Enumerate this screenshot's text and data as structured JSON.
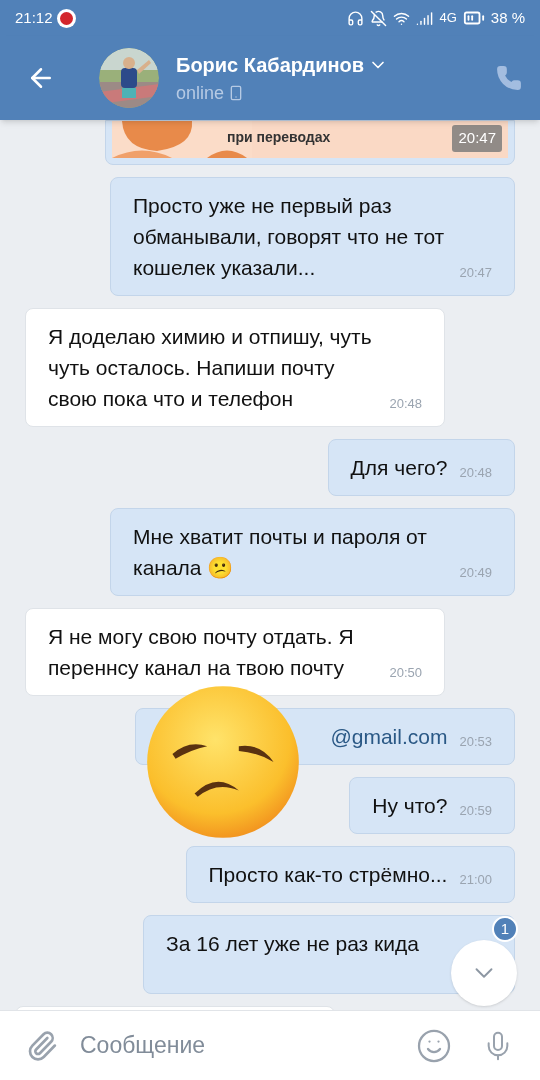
{
  "status_bar": {
    "time": "21:12",
    "network": "4G",
    "battery": "38 %"
  },
  "header": {
    "name": "Борис Кабардинов",
    "status": "online"
  },
  "image_message": {
    "caption": "при переводах",
    "time": "20:47"
  },
  "messages": [
    {
      "kind": "outgoing",
      "text": "Просто уже не первый раз обманывали, говорят что не тот кошелек указали...",
      "time": "20:47",
      "covered": false
    },
    {
      "kind": "incoming",
      "text": "Я доделаю химию и отпишу, чуть чуть осталось. Напиши почту свою пока что и телефон",
      "time": "20:48",
      "covered": false
    },
    {
      "kind": "outgoing",
      "text": "Для чего?",
      "time": "20:48",
      "covered": false
    },
    {
      "kind": "outgoing",
      "text": "Мне хватит почты и пароля от канала 😕",
      "time": "20:49",
      "covered": false
    },
    {
      "kind": "incoming",
      "text": "Я не могу свою почту отдать. Я переннсу канал на твою почту",
      "time": "20:50",
      "covered": false
    },
    {
      "kind": "outgoing",
      "text": "@gmail.com",
      "time": "20:53",
      "covered": true
    },
    {
      "kind": "outgoing",
      "text": "Ну что?",
      "time": "20:59",
      "covered": false
    },
    {
      "kind": "outgoing",
      "text": "Просто как-то стрёмно...",
      "time": "21:00",
      "covered": false
    },
    {
      "kind": "outgoing",
      "text": "За 16 лет уже не раз кида",
      "covered": false
    }
  ],
  "scroll_button": {
    "badge": "1"
  },
  "input": {
    "placeholder": "Сообщение"
  }
}
